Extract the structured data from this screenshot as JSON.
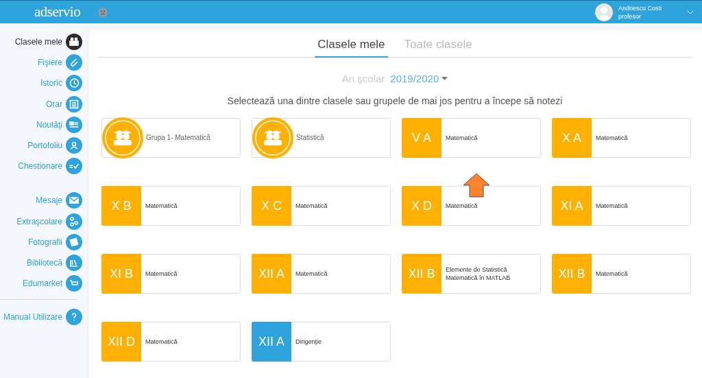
{
  "header": {
    "logo": "adservio",
    "user": {
      "name": "Andriescu Costi",
      "role": "profesor"
    }
  },
  "sidebar": {
    "groups": [
      {
        "divider": false,
        "items": [
          {
            "label": "Clasele mele",
            "selected": true
          },
          {
            "label": "Fişiere",
            "selected": false
          },
          {
            "label": "Istoric",
            "selected": false
          },
          {
            "label": "Orar",
            "selected": false
          },
          {
            "label": "Noutăţi",
            "selected": false
          },
          {
            "label": "Portofoliu",
            "selected": false
          },
          {
            "label": "Chestionare",
            "selected": false
          }
        ]
      },
      {
        "divider": false,
        "items": [
          {
            "label": "Mesaje",
            "selected": false
          },
          {
            "label": "Extraşcolare",
            "selected": false
          },
          {
            "label": "Fotografii",
            "selected": false
          },
          {
            "label": "Bibliotecă",
            "selected": false
          },
          {
            "label": "Edumarket",
            "selected": false
          }
        ]
      },
      {
        "divider": true,
        "items": [
          {
            "label": "Manual Utilizare",
            "selected": false
          }
        ]
      }
    ]
  },
  "tabs": [
    {
      "label": "Clasele mele",
      "selected": true
    },
    {
      "label": "Toate clasele",
      "selected": false
    }
  ],
  "year": {
    "label": "An şcolar",
    "value": "2019/2020"
  },
  "instruction": "Selectează una dintre clasele sau grupele de mai jos pentru a începe să notezi",
  "cards": [
    {
      "kind": "group",
      "subject": "Grupa 1- Matematică"
    },
    {
      "kind": "group",
      "subject": "Statistică"
    },
    {
      "kind": "class",
      "label": "V A",
      "subject": "Matematică",
      "color": "#ffb000"
    },
    {
      "kind": "class",
      "label": "X A",
      "subject": "Matematică",
      "color": "#ffb000"
    },
    {
      "kind": "class",
      "label": "X B",
      "subject": "Matematică",
      "color": "#ffb000"
    },
    {
      "kind": "class",
      "label": "X C",
      "subject": "Matematică",
      "color": "#ffb000"
    },
    {
      "kind": "class",
      "label": "X D",
      "subject": "Matematică",
      "color": "#ffb000"
    },
    {
      "kind": "class",
      "label": "XI A",
      "subject": "Matematică",
      "color": "#ffb000"
    },
    {
      "kind": "class",
      "label": "XI B",
      "subject": "Matematică",
      "color": "#ffb000"
    },
    {
      "kind": "class",
      "label": "XII A",
      "subject": "Matematică",
      "color": "#ffb000"
    },
    {
      "kind": "class",
      "label": "XII B",
      "subject": "Elemente de Statistică Matematică în MATLAB",
      "color": "#ffb000"
    },
    {
      "kind": "class",
      "label": "XII B",
      "subject": "Matematică",
      "color": "#ffb000"
    },
    {
      "kind": "class",
      "label": "XII D",
      "subject": "Matematică",
      "color": "#ffb000"
    },
    {
      "kind": "class",
      "label": "XII A",
      "subject": "Dirigenţie",
      "color": "#2ea3dc"
    }
  ]
}
